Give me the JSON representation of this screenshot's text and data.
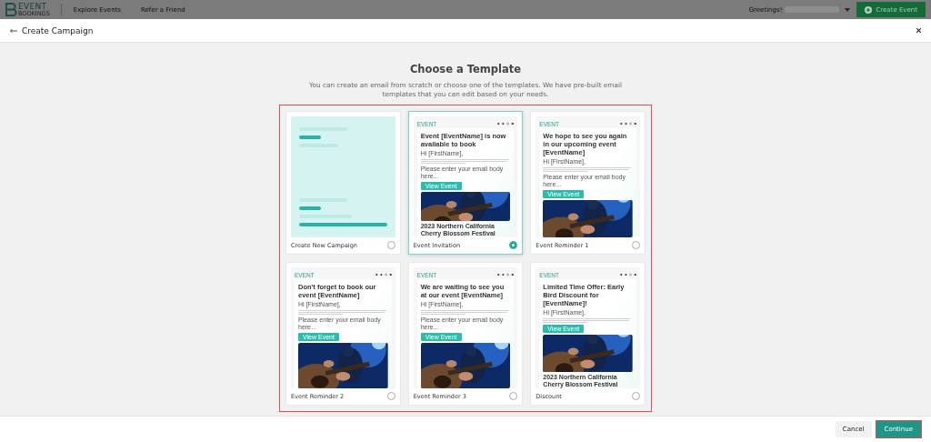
{
  "header": {
    "logo_top": "EVENT",
    "logo_bottom": "BOOKINGS",
    "nav": [
      {
        "label": "Explore Events"
      },
      {
        "label": "Refer a Friend"
      }
    ],
    "greeting": "Greetings!",
    "create_button": "Create Event"
  },
  "modal": {
    "title": "Create Campaign"
  },
  "heading": "Choose a Template",
  "subtitle": "You can create an email from scratch or choose one of the templates. We have pre-built email templates that you can edit based on your needs.",
  "grid_highlighted": true,
  "templates": [
    {
      "kind": "blank",
      "name": "Create New Campaign",
      "selected": false
    },
    {
      "kind": "email",
      "name": "Event Invitation",
      "selected": true,
      "logo_text": "EVENT",
      "heading": "Event [EventName] is now available to book",
      "greeting": "Hi [FirstName],",
      "prompt": "Please enter your email body here...",
      "button": "View Event",
      "caption": "2023 Northern California Cherry Blossom Festival"
    },
    {
      "kind": "email",
      "name": "Event Reminder 1",
      "selected": false,
      "logo_text": "EVENT",
      "heading": "We hope to see you again in our upcoming event [EventName]",
      "greeting": "Hi [FirstName],",
      "prompt": "Please enter your email body here...",
      "button": "View Event"
    },
    {
      "kind": "email",
      "name": "Event Reminder 2",
      "selected": false,
      "logo_text": "EVENT",
      "heading": "Don't forget to book our event [EventName]",
      "greeting": "Hi [FirstName],",
      "prompt": "Please enter your email body here...",
      "button": "View Event"
    },
    {
      "kind": "email",
      "name": "Event Reminder 3",
      "selected": false,
      "logo_text": "EVENT",
      "heading": "We are waiting to see you at our event [EventName]",
      "greeting": "Hi [FirstName],",
      "prompt": "Please enter your email body here...",
      "button": "View Event"
    },
    {
      "kind": "email",
      "name": "Discount",
      "selected": false,
      "logo_text": "EVENT",
      "heading": "Limited Time Offer: Early Bird Discount for [EventName]!",
      "greeting": "Hi [FirstName],",
      "button": "View Event",
      "caption": "2023 Northern California Cherry Blossom Festival"
    }
  ],
  "footer": {
    "cancel": "Cancel",
    "continue": "Continue",
    "continue_highlighted": true
  }
}
